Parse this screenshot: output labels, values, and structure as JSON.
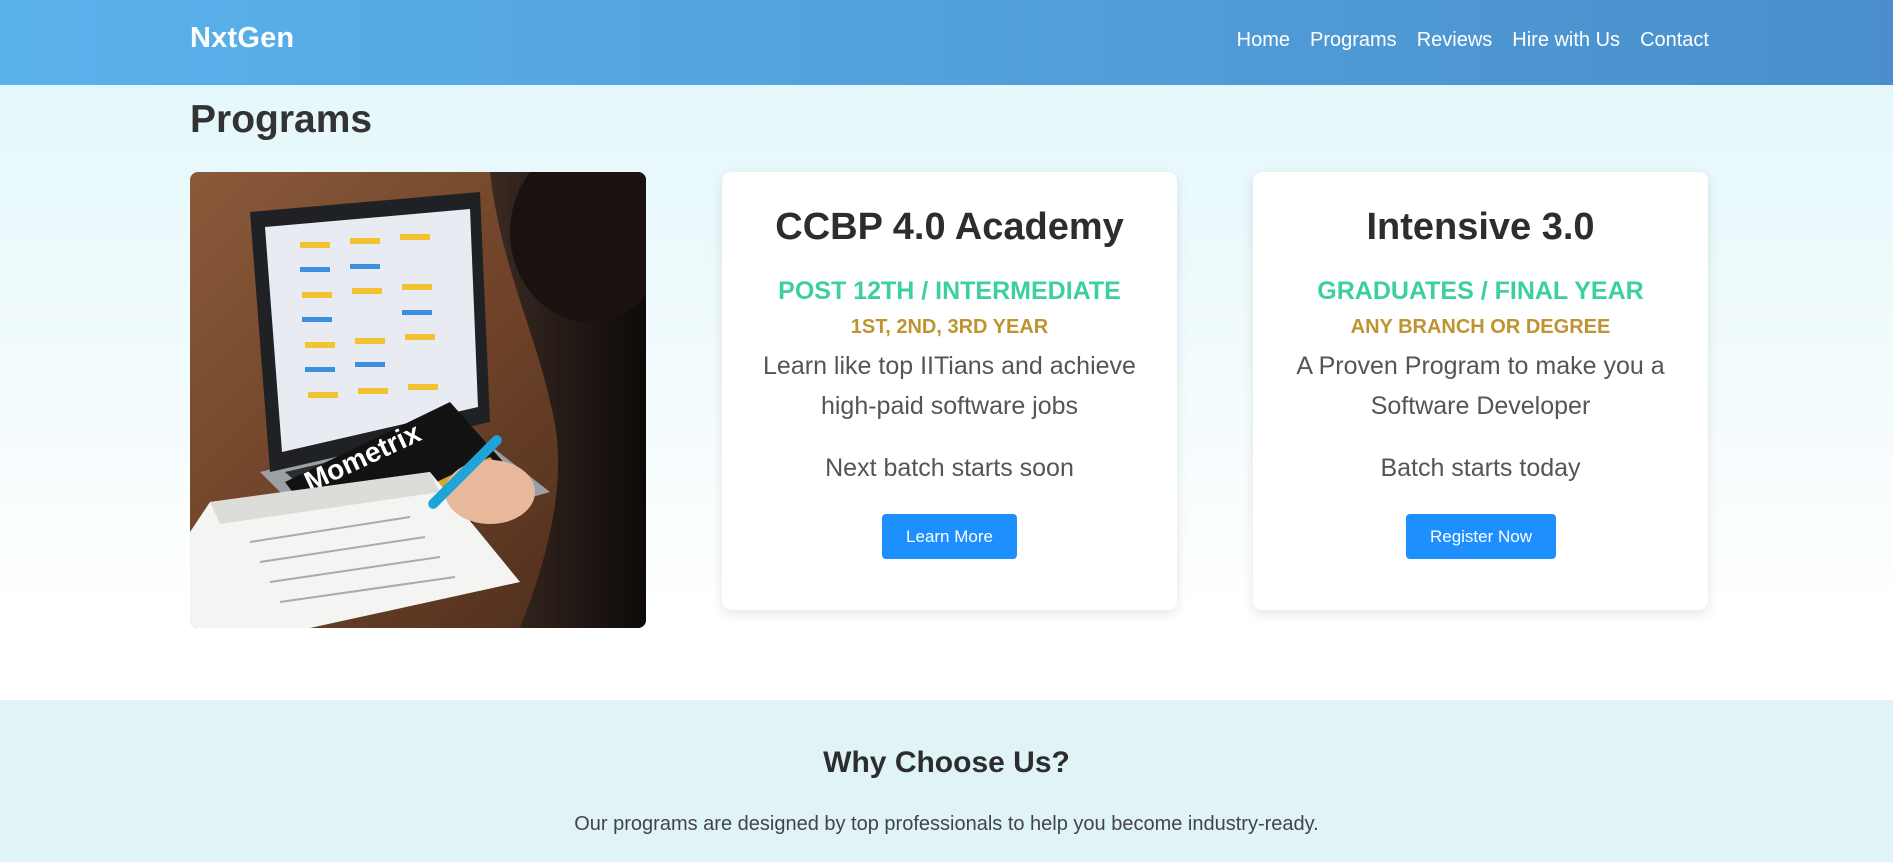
{
  "header": {
    "brand": "NxtGen",
    "nav": [
      "Home",
      "Programs",
      "Reviews",
      "Hire with Us",
      "Contact"
    ]
  },
  "programs": {
    "title": "Programs",
    "image_alt": "student studying with laptop and test-prep book",
    "cards": [
      {
        "title": "CCBP 4.0 Academy",
        "subtitle": "POST 12TH / INTERMEDIATE",
        "tagline": "1ST, 2ND, 3RD YEAR",
        "description": "Learn like top IITians and achieve high-paid software jobs",
        "batch": "Next batch starts soon",
        "button": "Learn More"
      },
      {
        "title": "Intensive 3.0",
        "subtitle": "GRADUATES / FINAL YEAR",
        "tagline": "ANY BRANCH OR DEGREE",
        "description": "A Proven Program to make you a Software Developer",
        "batch": "Batch starts today",
        "button": "Register Now"
      }
    ]
  },
  "why": {
    "title": "Why Choose Us?",
    "text": "Our programs are designed by top professionals to help you become industry-ready."
  },
  "colors": {
    "header_start": "#5ab2eb",
    "header_end": "#4a8fcc",
    "accent_green": "#3cd0a0",
    "accent_gold": "#bf9430",
    "button_blue": "#1e8fff"
  }
}
